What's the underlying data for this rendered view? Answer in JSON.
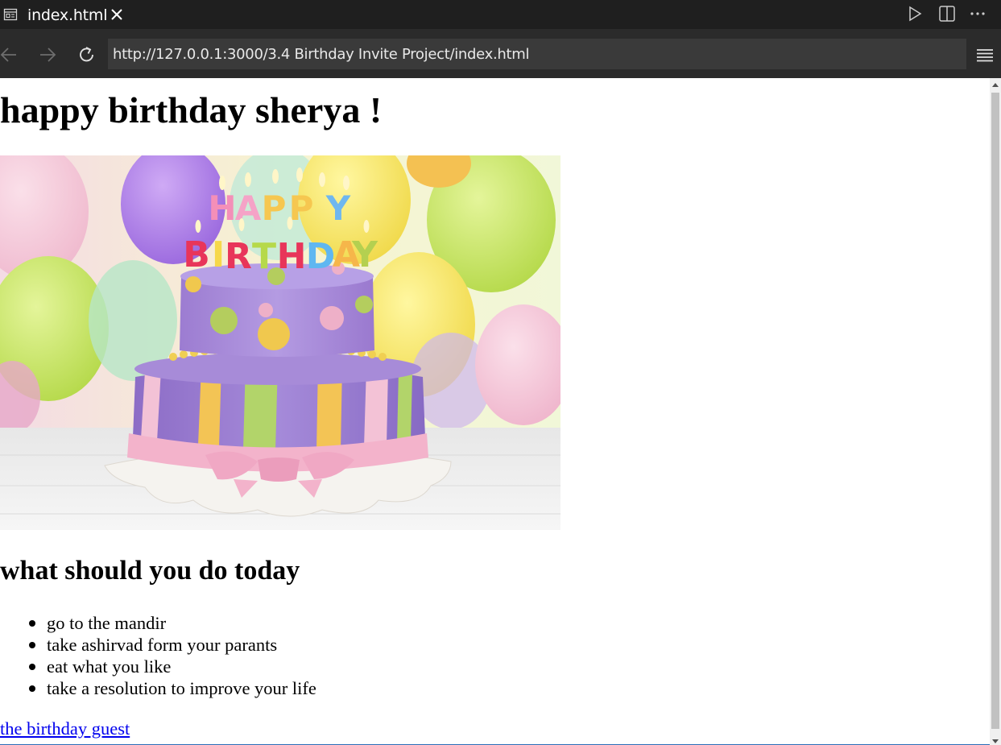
{
  "tab": {
    "title": "index.html",
    "icon": "preview-icon",
    "close_icon": "close-icon"
  },
  "tab_actions": [
    "run-icon",
    "split-editor-icon",
    "more-actions-icon"
  ],
  "navigation": {
    "back_icon": "arrow-left-icon",
    "forward_icon": "arrow-right-icon",
    "reload_icon": "reload-icon",
    "url": "http://127.0.0.1:3000/3.4 Birthday Invite Project/index.html",
    "menu_icon": "hamburger-menu-icon"
  },
  "page": {
    "heading": "happy birthday sherya !",
    "image_letters": [
      "HAPPY",
      "BIRTHDAY"
    ],
    "subheading": "what should you do today",
    "todo_items": [
      "go to the mandir",
      "take ashirvad form your parants",
      "eat what you like",
      "take a resolution to improve your life"
    ],
    "link_text": "the birthday guest"
  },
  "colors": {
    "chrome_bg": "#1f1f1f",
    "addressbar_bg": "#2b2b2b",
    "url_field_bg": "#3a3a3a",
    "link": "#0000ee"
  }
}
